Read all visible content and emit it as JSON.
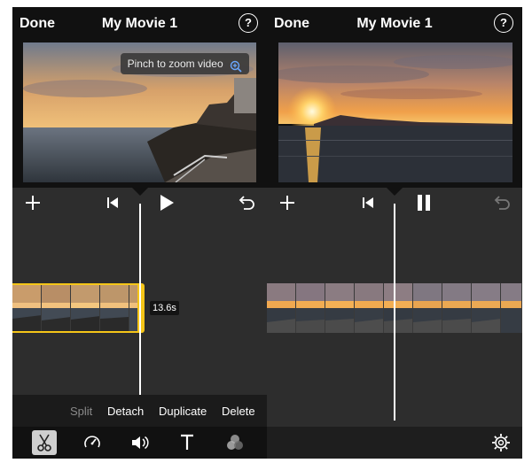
{
  "left": {
    "header": {
      "done_label": "Done",
      "title": "My Movie 1",
      "help_label": "?"
    },
    "viewer": {
      "hint_text": "Pinch to zoom video",
      "hint_icon": "zoom-in-icon"
    },
    "controls": {
      "add_icon": "plus-icon",
      "rewind_icon": "skip-back-icon",
      "play_icon": "play-icon",
      "undo_icon": "undo-icon"
    },
    "clip": {
      "duration": "13.6s",
      "selected": true
    },
    "actions": {
      "split": "Split",
      "detach": "Detach",
      "duplicate": "Duplicate",
      "delete": "Delete"
    },
    "toolbar": {
      "tools": [
        "scissors-icon",
        "speed-gauge-icon",
        "volume-icon",
        "title-text-icon",
        "filters-icon"
      ]
    }
  },
  "right": {
    "header": {
      "done_label": "Done",
      "title": "My Movie 1",
      "help_label": "?"
    },
    "controls": {
      "add_icon": "plus-icon",
      "rewind_icon": "skip-back-icon",
      "pause_icon": "pause-icon",
      "undo_icon": "undo-icon"
    },
    "toolbar": {
      "settings_icon": "gear-icon"
    }
  },
  "colors": {
    "selection": "#f5c518",
    "panel": "#2d2d2d",
    "bar": "#111111"
  }
}
